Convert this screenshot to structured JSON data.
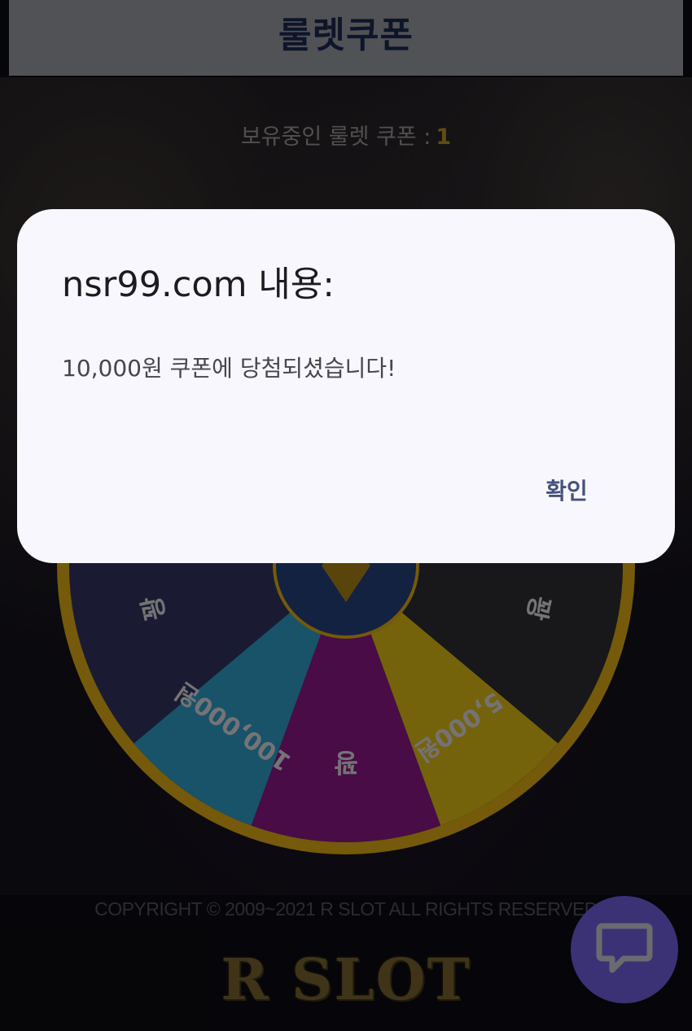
{
  "header": {
    "title": "룰렛쿠폰"
  },
  "coupon": {
    "label": "보유중인 룰렛 쿠폰 :",
    "count": "1"
  },
  "wheel": {
    "segments": [
      {
        "label": "꽝",
        "color": "#2d2f56"
      },
      {
        "label": "100,000원",
        "color": "#2a8fb5"
      },
      {
        "label": "꽝",
        "color": "#7e157b"
      },
      {
        "label": "5,000원",
        "color": "#c9ab13"
      },
      {
        "label": "꽝",
        "color": "#2a2a2e"
      }
    ],
    "rim_color": "#c89b12",
    "hub_color": "#1f3c6f"
  },
  "footer": {
    "copyright": "COPYRIGHT © 2009~2021 R SLOT ALL RIGHTS RESERVED",
    "brand": "R SLOT"
  },
  "dialog": {
    "title": "nsr99.com 내용:",
    "message": "10,000원 쿠폰에 당첨되셨습니다!",
    "confirm": "확인"
  },
  "chat": {
    "icon": "chat-bubble-icon",
    "color": "#3b3275"
  }
}
